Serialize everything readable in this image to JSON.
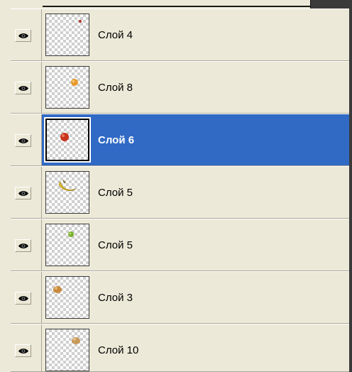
{
  "layers_panel": {
    "layers": [
      {
        "name": "Слой 4",
        "visible": true,
        "selected": false,
        "thumbnail": "small-red-speck",
        "fruit_color": "#b03a2e"
      },
      {
        "name": "Слой 8",
        "visible": true,
        "selected": false,
        "thumbnail": "orange-fruit",
        "fruit_color": "#e89a2c"
      },
      {
        "name": "Слой 6",
        "visible": true,
        "selected": true,
        "thumbnail": "red-apple",
        "fruit_color": "#c8351f"
      },
      {
        "name": "Слой 5",
        "visible": true,
        "selected": false,
        "thumbnail": "banana",
        "fruit_color": "#e8c531"
      },
      {
        "name": "Слой 5",
        "visible": true,
        "selected": false,
        "thumbnail": "green-fruit",
        "fruit_color": "#7ab02c"
      },
      {
        "name": "Слой 3",
        "visible": true,
        "selected": false,
        "thumbnail": "brown-fruit",
        "fruit_color": "#c98a3d"
      },
      {
        "name": "Слой 10",
        "visible": true,
        "selected": false,
        "thumbnail": "tan-fruit",
        "fruit_color": "#c9995a"
      }
    ]
  },
  "colors": {
    "panel_bg": "#ece9d8",
    "selection": "#316ac5"
  }
}
